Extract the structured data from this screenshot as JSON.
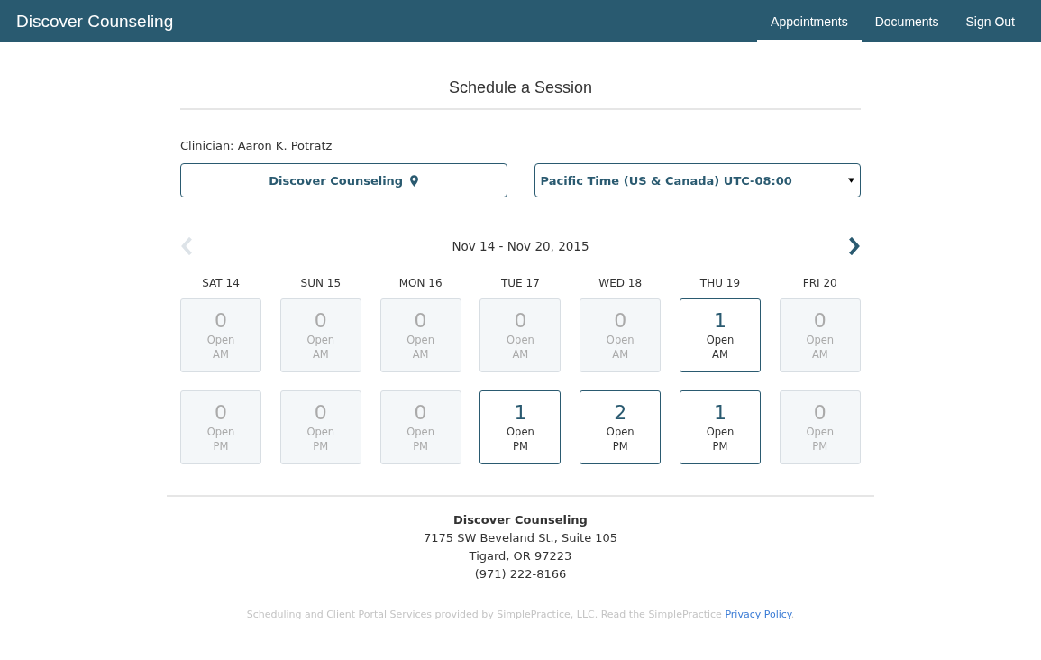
{
  "brand": "Discover Counseling",
  "nav": [
    {
      "label": "Appointments",
      "selected": true
    },
    {
      "label": "Documents",
      "selected": false
    },
    {
      "label": "Sign Out",
      "selected": false
    }
  ],
  "heading": "Schedule a Session",
  "clinician": "Clinician: Aaron K. Potratz",
  "location_button": "Discover Counseling",
  "timezone": {
    "value": "Pacific Time (US & Canada) UTC-08:00"
  },
  "week": {
    "range": "Nov 14 - Nov 20, 2015",
    "prev_disabled": true,
    "next_disabled": false
  },
  "days": [
    {
      "label": "SAT 14",
      "slots": [
        {
          "count": "0",
          "label": "Open",
          "period": "AM",
          "disabled": true
        },
        {
          "count": "0",
          "label": "Open",
          "period": "PM",
          "disabled": true
        }
      ]
    },
    {
      "label": "SUN 15",
      "slots": [
        {
          "count": "0",
          "label": "Open",
          "period": "AM",
          "disabled": true
        },
        {
          "count": "0",
          "label": "Open",
          "period": "PM",
          "disabled": true
        }
      ]
    },
    {
      "label": "MON 16",
      "slots": [
        {
          "count": "0",
          "label": "Open",
          "period": "AM",
          "disabled": true
        },
        {
          "count": "0",
          "label": "Open",
          "period": "PM",
          "disabled": true
        }
      ]
    },
    {
      "label": "TUE 17",
      "slots": [
        {
          "count": "0",
          "label": "Open",
          "period": "AM",
          "disabled": true
        },
        {
          "count": "1",
          "label": "Open",
          "period": "PM",
          "disabled": false
        }
      ]
    },
    {
      "label": "WED 18",
      "slots": [
        {
          "count": "0",
          "label": "Open",
          "period": "AM",
          "disabled": true
        },
        {
          "count": "2",
          "label": "Open",
          "period": "PM",
          "disabled": false
        }
      ]
    },
    {
      "label": "THU 19",
      "slots": [
        {
          "count": "1",
          "label": "Open",
          "period": "AM",
          "disabled": false
        },
        {
          "count": "1",
          "label": "Open",
          "period": "PM",
          "disabled": false
        }
      ]
    },
    {
      "label": "FRI 20",
      "slots": [
        {
          "count": "0",
          "label": "Open",
          "period": "AM",
          "disabled": true
        },
        {
          "count": "0",
          "label": "Open",
          "period": "PM",
          "disabled": true
        }
      ]
    }
  ],
  "practice": {
    "name": "Discover Counseling",
    "lines": [
      "7175 SW Beveland St., Suite 105",
      "Tigard, OR 97223",
      "(971) 222-8166"
    ]
  },
  "disclaimer": {
    "text": "Scheduling and Client Portal Services provided by SimplePractice, LLC. Read the SimplePractice ",
    "link": "Privacy Policy",
    "end": "."
  }
}
